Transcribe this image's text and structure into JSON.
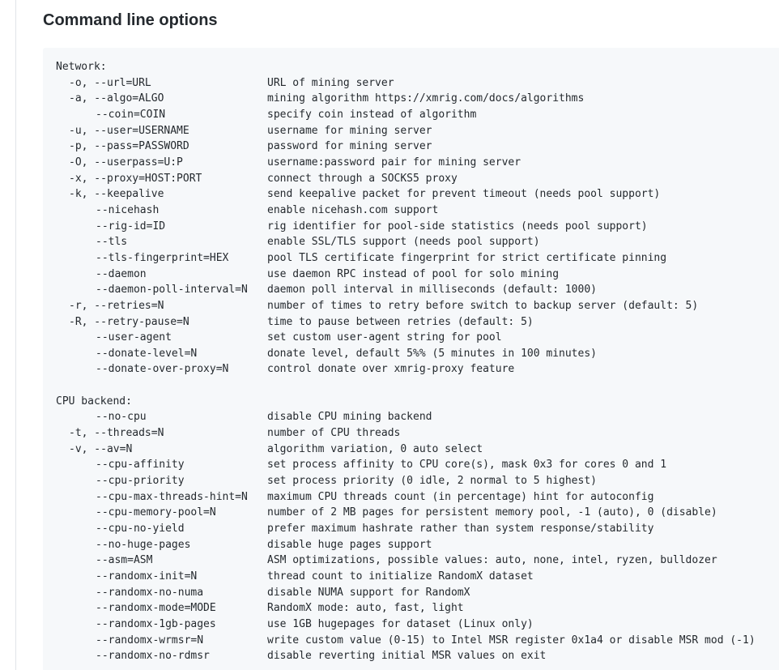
{
  "heading": "Command line options",
  "sections": [
    {
      "label": "Network:",
      "options": [
        {
          "opt": "-o, --url=URL",
          "desc": "URL of mining server",
          "indent": 2
        },
        {
          "opt": "-a, --algo=ALGO",
          "desc": "mining algorithm https://xmrig.com/docs/algorithms",
          "indent": 2
        },
        {
          "opt": "--coin=COIN",
          "desc": "specify coin instead of algorithm",
          "indent": 6
        },
        {
          "opt": "-u, --user=USERNAME",
          "desc": "username for mining server",
          "indent": 2
        },
        {
          "opt": "-p, --pass=PASSWORD",
          "desc": "password for mining server",
          "indent": 2
        },
        {
          "opt": "-O, --userpass=U:P",
          "desc": "username:password pair for mining server",
          "indent": 2
        },
        {
          "opt": "-x, --proxy=HOST:PORT",
          "desc": "connect through a SOCKS5 proxy",
          "indent": 2
        },
        {
          "opt": "-k, --keepalive",
          "desc": "send keepalive packet for prevent timeout (needs pool support)",
          "indent": 2
        },
        {
          "opt": "--nicehash",
          "desc": "enable nicehash.com support",
          "indent": 6
        },
        {
          "opt": "--rig-id=ID",
          "desc": "rig identifier for pool-side statistics (needs pool support)",
          "indent": 6
        },
        {
          "opt": "--tls",
          "desc": "enable SSL/TLS support (needs pool support)",
          "indent": 6
        },
        {
          "opt": "--tls-fingerprint=HEX",
          "desc": "pool TLS certificate fingerprint for strict certificate pinning",
          "indent": 6
        },
        {
          "opt": "--daemon",
          "desc": "use daemon RPC instead of pool for solo mining",
          "indent": 6
        },
        {
          "opt": "--daemon-poll-interval=N",
          "desc": "daemon poll interval in milliseconds (default: 1000)",
          "indent": 6
        },
        {
          "opt": "-r, --retries=N",
          "desc": "number of times to retry before switch to backup server (default: 5)",
          "indent": 2
        },
        {
          "opt": "-R, --retry-pause=N",
          "desc": "time to pause between retries (default: 5)",
          "indent": 2
        },
        {
          "opt": "--user-agent",
          "desc": "set custom user-agent string for pool",
          "indent": 6
        },
        {
          "opt": "--donate-level=N",
          "desc": "donate level, default 5%% (5 minutes in 100 minutes)",
          "indent": 6
        },
        {
          "opt": "--donate-over-proxy=N",
          "desc": "control donate over xmrig-proxy feature",
          "indent": 6
        }
      ]
    },
    {
      "label": "CPU backend:",
      "options": [
        {
          "opt": "--no-cpu",
          "desc": "disable CPU mining backend",
          "indent": 6
        },
        {
          "opt": "-t, --threads=N",
          "desc": "number of CPU threads",
          "indent": 2
        },
        {
          "opt": "-v, --av=N",
          "desc": "algorithm variation, 0 auto select",
          "indent": 2
        },
        {
          "opt": "--cpu-affinity",
          "desc": "set process affinity to CPU core(s), mask 0x3 for cores 0 and 1",
          "indent": 6
        },
        {
          "opt": "--cpu-priority",
          "desc": "set process priority (0 idle, 2 normal to 5 highest)",
          "indent": 6
        },
        {
          "opt": "--cpu-max-threads-hint=N",
          "desc": "maximum CPU threads count (in percentage) hint for autoconfig",
          "indent": 6
        },
        {
          "opt": "--cpu-memory-pool=N",
          "desc": "number of 2 MB pages for persistent memory pool, -1 (auto), 0 (disable)",
          "indent": 6
        },
        {
          "opt": "--cpu-no-yield",
          "desc": "prefer maximum hashrate rather than system response/stability",
          "indent": 6
        },
        {
          "opt": "--no-huge-pages",
          "desc": "disable huge pages support",
          "indent": 6
        },
        {
          "opt": "--asm=ASM",
          "desc": "ASM optimizations, possible values: auto, none, intel, ryzen, bulldozer",
          "indent": 6
        },
        {
          "opt": "--randomx-init=N",
          "desc": "thread count to initialize RandomX dataset",
          "indent": 6
        },
        {
          "opt": "--randomx-no-numa",
          "desc": "disable NUMA support for RandomX",
          "indent": 6
        },
        {
          "opt": "--randomx-mode=MODE",
          "desc": "RandomX mode: auto, fast, light",
          "indent": 6
        },
        {
          "opt": "--randomx-1gb-pages",
          "desc": "use 1GB hugepages for dataset (Linux only)",
          "indent": 6
        },
        {
          "opt": "--randomx-wrmsr=N",
          "desc": "write custom value (0-15) to Intel MSR register 0x1a4 or disable MSR mod (-1)",
          "indent": 6
        },
        {
          "opt": "--randomx-no-rdmsr",
          "desc": "disable reverting initial MSR values on exit",
          "indent": 6
        }
      ]
    }
  ]
}
